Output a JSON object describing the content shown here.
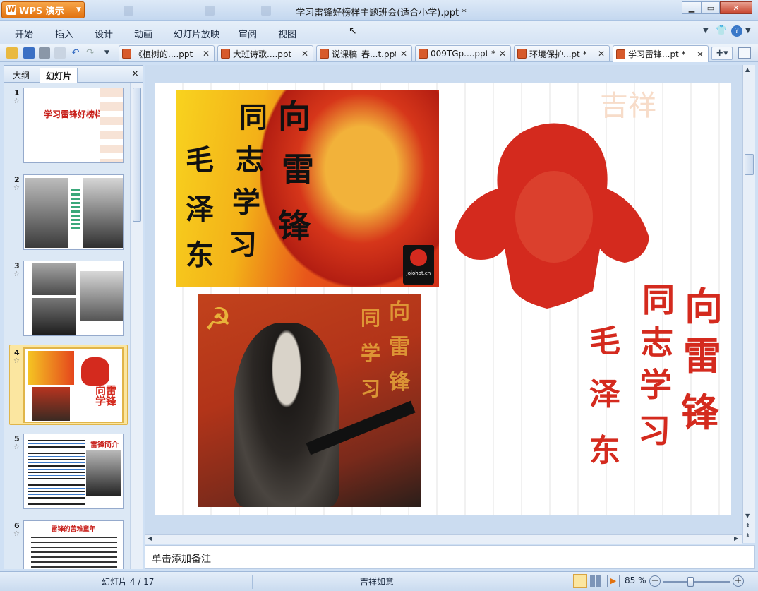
{
  "app": {
    "name": "WPS 演示",
    "title": "学习雷锋好榜样主题班会(适合小学).ppt *"
  },
  "menu": [
    "开始",
    "插入",
    "设计",
    "动画",
    "幻灯片放映",
    "审阅",
    "视图"
  ],
  "tabs": [
    {
      "label": "《植树的....ppt",
      "active": false
    },
    {
      "label": "大班诗歌....ppt",
      "active": false
    },
    {
      "label": "说课稿_春...t.ppt",
      "active": false
    },
    {
      "label": "009TGp....ppt *",
      "active": false
    },
    {
      "label": "环境保护...pt *",
      "active": false
    },
    {
      "label": "学习雷锋...pt *",
      "active": true
    }
  ],
  "panel": {
    "tabs": [
      "大纲",
      "幻灯片"
    ],
    "active_tab": "幻灯片",
    "close": "×"
  },
  "thumbnails": [
    {
      "num": "1",
      "star": "☆",
      "title": "学习雷锋好榜样"
    },
    {
      "num": "2",
      "star": "☆"
    },
    {
      "num": "3",
      "star": "☆"
    },
    {
      "num": "4",
      "star": "☆",
      "selected": true
    },
    {
      "num": "5",
      "star": "☆",
      "title": "雷锋简介"
    },
    {
      "num": "6",
      "star": "☆",
      "title": "雷锋的苦难童年"
    }
  ],
  "slide": {
    "calligraphy": [
      "向",
      "雷",
      "锋",
      "同",
      "志",
      "学",
      "习",
      "毛",
      "泽",
      "东"
    ],
    "watermark": "jojohot.cn"
  },
  "notes_placeholder": "单击添加备注",
  "status": {
    "slide_label": "幻灯片 4 / 17",
    "theme": "吉祥如意",
    "zoom": "85 %"
  },
  "colors": {
    "accent": "#e2720f",
    "red": "#d42a1e"
  }
}
